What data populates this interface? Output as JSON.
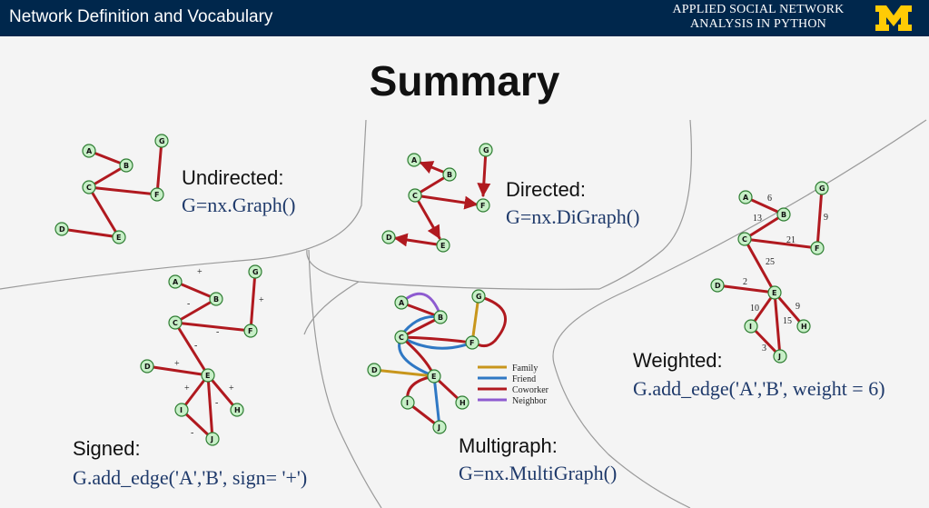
{
  "header": {
    "deck_title": "Network Definition and Vocabulary",
    "course_line1": "APPLIED SOCIAL NETWORK",
    "course_line2": "ANALYSIS IN PYTHON",
    "logo_icon": "block-m-logo-icon",
    "bar_color": "#00274c",
    "logo_color": "#ffcb05"
  },
  "slide": {
    "title": "Summary"
  },
  "panels": {
    "undirected": {
      "caption": "Undirected:",
      "code": "G=nx.Graph()"
    },
    "directed": {
      "caption": "Directed:",
      "code": "G=nx.DiGraph()"
    },
    "weighted": {
      "caption": "Weighted:",
      "code": "G.add_edge('A','B', weight = 6)"
    },
    "signed": {
      "caption": "Signed:",
      "code": "G.add_edge('A','B', sign= '+')"
    },
    "multigraph": {
      "caption": "Multigraph:",
      "code": "G=nx.MultiGraph()"
    }
  },
  "node_labels": [
    "A",
    "B",
    "C",
    "D",
    "E",
    "F",
    "G",
    "H",
    "I",
    "J"
  ],
  "weights": [
    "6",
    "13",
    "21",
    "25",
    "2",
    "10",
    "9",
    "15",
    "3",
    "9"
  ],
  "signs": [
    "+",
    "-",
    "+",
    "-",
    "+",
    "+",
    "+",
    "-",
    "-",
    "-"
  ],
  "legend": {
    "items": [
      {
        "label": "Family",
        "color": "#c8961c"
      },
      {
        "label": "Friend",
        "color": "#2f78c4"
      },
      {
        "label": "Coworker",
        "color": "#b0191f"
      },
      {
        "label": "Neighbor",
        "color": "#8e5bd0"
      }
    ]
  },
  "colors": {
    "edge": "#b0191f",
    "node_fill": "#c7efc7",
    "node_stroke": "#2e7d32",
    "code_text": "#1f3a6b"
  }
}
